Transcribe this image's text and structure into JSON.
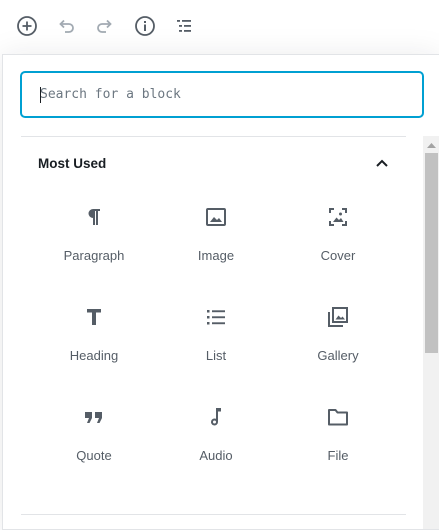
{
  "toolbar": {
    "buttons": [
      {
        "name": "add-block",
        "icon": "plus-circle-icon"
      },
      {
        "name": "undo",
        "icon": "undo-icon"
      },
      {
        "name": "redo",
        "icon": "redo-icon"
      },
      {
        "name": "info",
        "icon": "info-icon"
      },
      {
        "name": "outline",
        "icon": "list-outline-icon"
      }
    ]
  },
  "inserter": {
    "search": {
      "placeholder": "Search for a block",
      "value": ""
    },
    "panel": {
      "title": "Most Used",
      "expanded": true
    },
    "blocks": [
      {
        "label": "Paragraph",
        "icon": "paragraph-icon"
      },
      {
        "label": "Image",
        "icon": "image-icon"
      },
      {
        "label": "Cover",
        "icon": "cover-icon"
      },
      {
        "label": "Heading",
        "icon": "heading-icon"
      },
      {
        "label": "List",
        "icon": "list-icon"
      },
      {
        "label": "Gallery",
        "icon": "gallery-icon"
      },
      {
        "label": "Quote",
        "icon": "quote-icon"
      },
      {
        "label": "Audio",
        "icon": "audio-icon"
      },
      {
        "label": "File",
        "icon": "file-icon"
      }
    ]
  },
  "colors": {
    "accent": "#00a0d2",
    "icon": "#555d66",
    "text": "#191e23",
    "disabled": "#a2aab2"
  }
}
